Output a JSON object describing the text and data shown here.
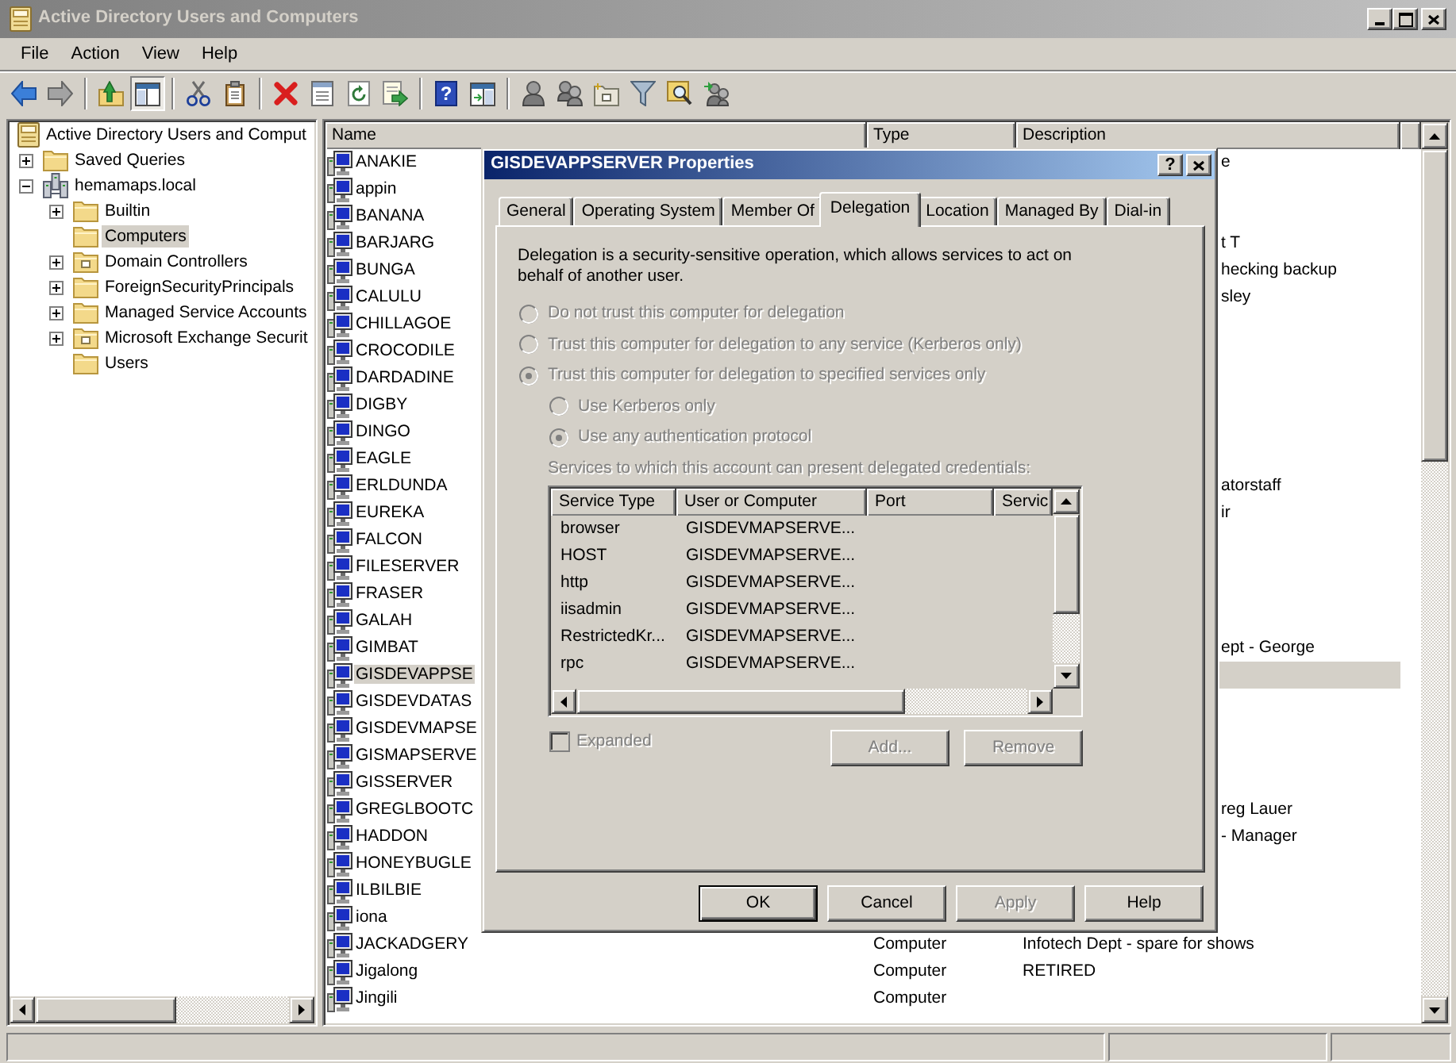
{
  "window": {
    "title": "Active Directory Users and Computers",
    "active": false
  },
  "menu": [
    "File",
    "Action",
    "View",
    "Help"
  ],
  "toolbar": [
    [
      {
        "kind": "back",
        "pressed": false
      },
      {
        "kind": "forward",
        "pressed": false
      }
    ],
    [
      {
        "kind": "up",
        "pressed": false
      },
      {
        "kind": "console_tree",
        "pressed": true
      }
    ],
    [
      {
        "kind": "cut",
        "pressed": false
      },
      {
        "kind": "paste",
        "pressed": false
      }
    ],
    [
      {
        "kind": "delete",
        "pressed": false
      },
      {
        "kind": "properties",
        "pressed": false
      },
      {
        "kind": "refresh",
        "pressed": false
      },
      {
        "kind": "export",
        "pressed": false
      }
    ],
    [
      {
        "kind": "help",
        "label": "?",
        "pressed": false
      },
      {
        "kind": "action_pane",
        "pressed": false
      }
    ],
    [
      {
        "kind": "new_user",
        "pressed": false
      },
      {
        "kind": "new_group",
        "pressed": false
      },
      {
        "kind": "new_ou",
        "pressed": false
      },
      {
        "kind": "filter",
        "pressed": false
      },
      {
        "kind": "find",
        "pressed": false
      },
      {
        "kind": "add_to_group",
        "pressed": false
      }
    ]
  ],
  "tree": {
    "label": "Active Directory Users and Comput",
    "kind": "console",
    "selected": false,
    "children": [
      {
        "label": "Saved Queries",
        "kind": "folder",
        "expanded": false,
        "selected": false
      },
      {
        "label": "hemamaps.local",
        "kind": "domain",
        "expanded": true,
        "selected": false,
        "children": [
          {
            "label": "Builtin",
            "kind": "folder",
            "expanded": false,
            "selected": false
          },
          {
            "label": "Computers",
            "kind": "folder",
            "selected": true
          },
          {
            "label": "Domain Controllers",
            "kind": "org_unit",
            "expanded": false,
            "selected": false
          },
          {
            "label": "ForeignSecurityPrincipals",
            "kind": "folder",
            "expanded": false,
            "selected": false
          },
          {
            "label": "Managed Service Accounts",
            "kind": "folder",
            "expanded": false,
            "selected": false
          },
          {
            "label": "Microsoft Exchange Securit",
            "kind": "org_unit",
            "expanded": false,
            "selected": false
          },
          {
            "label": "Users",
            "kind": "folder",
            "selected": false
          }
        ]
      }
    ]
  },
  "list": {
    "columns": [
      "Name",
      "Type",
      "Description"
    ],
    "rows": [
      {
        "name": "ANAKIE",
        "description": "e",
        "selected": false
      },
      {
        "name": "appin",
        "selected": false
      },
      {
        "name": "BANANA",
        "selected": false
      },
      {
        "name": "BARJARG",
        "description": "t T",
        "selected": false
      },
      {
        "name": "BUNGA",
        "description": "hecking backup",
        "selected": false
      },
      {
        "name": "CALULU",
        "description": "sley",
        "selected": false
      },
      {
        "name": "CHILLAGOE",
        "selected": false
      },
      {
        "name": "CROCODILE",
        "selected": false
      },
      {
        "name": "DARDADINE",
        "selected": false
      },
      {
        "name": "DIGBY",
        "selected": false
      },
      {
        "name": "DINGO",
        "selected": false
      },
      {
        "name": "EAGLE",
        "selected": false
      },
      {
        "name": "ERLDUNDA",
        "description": "atorstaff",
        "selected": false
      },
      {
        "name": "EUREKA",
        "description": "ir",
        "selected": false
      },
      {
        "name": "FALCON",
        "selected": false
      },
      {
        "name": "FILESERVER",
        "selected": false
      },
      {
        "name": "FRASER",
        "selected": false
      },
      {
        "name": "GALAH",
        "selected": false
      },
      {
        "name": "GIMBAT",
        "description": "ept - George",
        "selected": false
      },
      {
        "name": "GISDEVAPPSE",
        "selected": true
      },
      {
        "name": "GISDEVDATAS",
        "selected": false
      },
      {
        "name": "GISDEVMAPSE",
        "selected": false
      },
      {
        "name": "GISMAPSERVE",
        "selected": false
      },
      {
        "name": "GISSERVER",
        "selected": false
      },
      {
        "name": "GREGLBOOTC",
        "description": "reg Lauer",
        "selected": false
      },
      {
        "name": "HADDON",
        "description": "- Manager",
        "selected": false
      },
      {
        "name": "HONEYBUGLE",
        "selected": false
      },
      {
        "name": "ILBILBIE",
        "selected": false
      },
      {
        "name": "iona",
        "selected": false
      },
      {
        "name": "JACKADGERY",
        "type": "Computer",
        "description": "Infotech Dept - spare for shows",
        "selected": false
      },
      {
        "name": "Jigalong",
        "type": "Computer",
        "description": "RETIRED",
        "selected": false
      },
      {
        "name": "Jingili",
        "type": "Computer",
        "selected": false
      }
    ]
  },
  "dialog": {
    "title": "GISDEVAPPSERVER Properties",
    "active": true,
    "help_button": "?",
    "tabs": [
      {
        "label": "General",
        "selected": false
      },
      {
        "label": "Operating System",
        "selected": false
      },
      {
        "label": "Member Of",
        "selected": false
      },
      {
        "label": "Delegation",
        "selected": true
      },
      {
        "label": "Location",
        "selected": false
      },
      {
        "label": "Managed By",
        "selected": false
      },
      {
        "label": "Dial-in",
        "selected": false
      }
    ],
    "intro": "Delegation is a security-sensitive operation, which allows services to act on behalf of another user.",
    "options": [
      {
        "label": "Do not trust this computer for delegation",
        "checked": false,
        "disabled": true
      },
      {
        "label": "Trust this computer for delegation to any service (Kerberos only)",
        "checked": false,
        "disabled": true
      },
      {
        "label": "Trust this computer for delegation to specified services only",
        "checked": true,
        "disabled": true,
        "children": [
          {
            "label": "Use Kerberos only",
            "checked": false,
            "disabled": true
          },
          {
            "label": "Use any authentication protocol",
            "checked": true,
            "disabled": true
          }
        ]
      }
    ],
    "services": {
      "label": "Services to which this account can present delegated credentials:",
      "disabled": true,
      "columns": [
        "Service Type",
        "User or Computer",
        "Port",
        "Servic"
      ],
      "rows": [
        [
          "browser",
          "GISDEVMAPSERVE..."
        ],
        [
          "HOST",
          "GISDEVMAPSERVE..."
        ],
        [
          "http",
          "GISDEVMAPSERVE..."
        ],
        [
          "iisadmin",
          "GISDEVMAPSERVE..."
        ],
        [
          "RestrictedKr...",
          "GISDEVMAPSERVE..."
        ],
        [
          "rpc",
          "GISDEVMAPSERVE..."
        ]
      ]
    },
    "checkbox": {
      "label": "Expanded",
      "checked": false,
      "disabled": true
    },
    "list_buttons": [
      {
        "label": "Add...",
        "disabled": true
      },
      {
        "label": "Remove",
        "disabled": true
      }
    ],
    "buttons": [
      {
        "label": "OK",
        "default": true,
        "disabled": false
      },
      {
        "label": "Cancel",
        "default": false,
        "disabled": false
      },
      {
        "label": "Apply",
        "default": false,
        "disabled": true
      },
      {
        "label": "Help",
        "default": false,
        "disabled": false
      }
    ]
  }
}
